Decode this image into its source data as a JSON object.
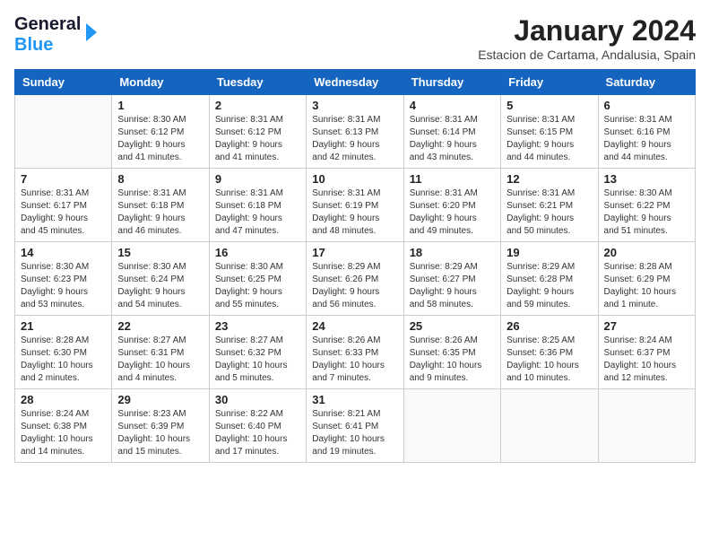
{
  "logo": {
    "line1": "General",
    "line2": "Blue"
  },
  "title": "January 2024",
  "location": "Estacion de Cartama, Andalusia, Spain",
  "weekdays": [
    "Sunday",
    "Monday",
    "Tuesday",
    "Wednesday",
    "Thursday",
    "Friday",
    "Saturday"
  ],
  "weeks": [
    [
      {
        "day": "",
        "info": ""
      },
      {
        "day": "1",
        "info": "Sunrise: 8:30 AM\nSunset: 6:12 PM\nDaylight: 9 hours\nand 41 minutes."
      },
      {
        "day": "2",
        "info": "Sunrise: 8:31 AM\nSunset: 6:12 PM\nDaylight: 9 hours\nand 41 minutes."
      },
      {
        "day": "3",
        "info": "Sunrise: 8:31 AM\nSunset: 6:13 PM\nDaylight: 9 hours\nand 42 minutes."
      },
      {
        "day": "4",
        "info": "Sunrise: 8:31 AM\nSunset: 6:14 PM\nDaylight: 9 hours\nand 43 minutes."
      },
      {
        "day": "5",
        "info": "Sunrise: 8:31 AM\nSunset: 6:15 PM\nDaylight: 9 hours\nand 44 minutes."
      },
      {
        "day": "6",
        "info": "Sunrise: 8:31 AM\nSunset: 6:16 PM\nDaylight: 9 hours\nand 44 minutes."
      }
    ],
    [
      {
        "day": "7",
        "info": "Sunrise: 8:31 AM\nSunset: 6:17 PM\nDaylight: 9 hours\nand 45 minutes."
      },
      {
        "day": "8",
        "info": "Sunrise: 8:31 AM\nSunset: 6:18 PM\nDaylight: 9 hours\nand 46 minutes."
      },
      {
        "day": "9",
        "info": "Sunrise: 8:31 AM\nSunset: 6:18 PM\nDaylight: 9 hours\nand 47 minutes."
      },
      {
        "day": "10",
        "info": "Sunrise: 8:31 AM\nSunset: 6:19 PM\nDaylight: 9 hours\nand 48 minutes."
      },
      {
        "day": "11",
        "info": "Sunrise: 8:31 AM\nSunset: 6:20 PM\nDaylight: 9 hours\nand 49 minutes."
      },
      {
        "day": "12",
        "info": "Sunrise: 8:31 AM\nSunset: 6:21 PM\nDaylight: 9 hours\nand 50 minutes."
      },
      {
        "day": "13",
        "info": "Sunrise: 8:30 AM\nSunset: 6:22 PM\nDaylight: 9 hours\nand 51 minutes."
      }
    ],
    [
      {
        "day": "14",
        "info": "Sunrise: 8:30 AM\nSunset: 6:23 PM\nDaylight: 9 hours\nand 53 minutes."
      },
      {
        "day": "15",
        "info": "Sunrise: 8:30 AM\nSunset: 6:24 PM\nDaylight: 9 hours\nand 54 minutes."
      },
      {
        "day": "16",
        "info": "Sunrise: 8:30 AM\nSunset: 6:25 PM\nDaylight: 9 hours\nand 55 minutes."
      },
      {
        "day": "17",
        "info": "Sunrise: 8:29 AM\nSunset: 6:26 PM\nDaylight: 9 hours\nand 56 minutes."
      },
      {
        "day": "18",
        "info": "Sunrise: 8:29 AM\nSunset: 6:27 PM\nDaylight: 9 hours\nand 58 minutes."
      },
      {
        "day": "19",
        "info": "Sunrise: 8:29 AM\nSunset: 6:28 PM\nDaylight: 9 hours\nand 59 minutes."
      },
      {
        "day": "20",
        "info": "Sunrise: 8:28 AM\nSunset: 6:29 PM\nDaylight: 10 hours\nand 1 minute."
      }
    ],
    [
      {
        "day": "21",
        "info": "Sunrise: 8:28 AM\nSunset: 6:30 PM\nDaylight: 10 hours\nand 2 minutes."
      },
      {
        "day": "22",
        "info": "Sunrise: 8:27 AM\nSunset: 6:31 PM\nDaylight: 10 hours\nand 4 minutes."
      },
      {
        "day": "23",
        "info": "Sunrise: 8:27 AM\nSunset: 6:32 PM\nDaylight: 10 hours\nand 5 minutes."
      },
      {
        "day": "24",
        "info": "Sunrise: 8:26 AM\nSunset: 6:33 PM\nDaylight: 10 hours\nand 7 minutes."
      },
      {
        "day": "25",
        "info": "Sunrise: 8:26 AM\nSunset: 6:35 PM\nDaylight: 10 hours\nand 9 minutes."
      },
      {
        "day": "26",
        "info": "Sunrise: 8:25 AM\nSunset: 6:36 PM\nDaylight: 10 hours\nand 10 minutes."
      },
      {
        "day": "27",
        "info": "Sunrise: 8:24 AM\nSunset: 6:37 PM\nDaylight: 10 hours\nand 12 minutes."
      }
    ],
    [
      {
        "day": "28",
        "info": "Sunrise: 8:24 AM\nSunset: 6:38 PM\nDaylight: 10 hours\nand 14 minutes."
      },
      {
        "day": "29",
        "info": "Sunrise: 8:23 AM\nSunset: 6:39 PM\nDaylight: 10 hours\nand 15 minutes."
      },
      {
        "day": "30",
        "info": "Sunrise: 8:22 AM\nSunset: 6:40 PM\nDaylight: 10 hours\nand 17 minutes."
      },
      {
        "day": "31",
        "info": "Sunrise: 8:21 AM\nSunset: 6:41 PM\nDaylight: 10 hours\nand 19 minutes."
      },
      {
        "day": "",
        "info": ""
      },
      {
        "day": "",
        "info": ""
      },
      {
        "day": "",
        "info": ""
      }
    ]
  ]
}
